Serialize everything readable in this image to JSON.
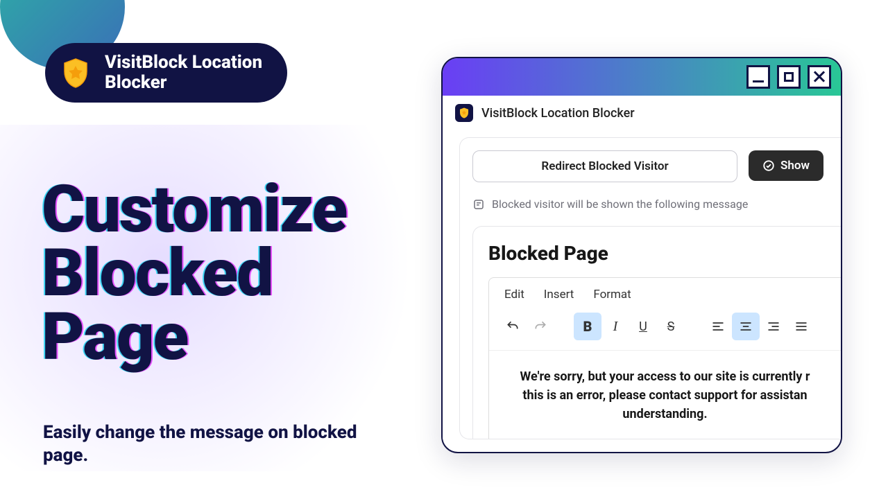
{
  "badge": {
    "label": "VisitBlock Location\nBlocker"
  },
  "headline": "Customize\nBlocked\nPage",
  "subtitle": "Easily change the message on blocked page.",
  "window": {
    "app_title": "VisitBlock Location Blocker",
    "tabs": {
      "redirect_label": "Redirect Blocked Visitor",
      "show_label": "Show"
    },
    "hint": "Blocked visitor will be shown the following message",
    "editor": {
      "title": "Blocked Page",
      "menus": [
        "Edit",
        "Insert",
        "Format"
      ],
      "content": "We're sorry, but your access to our site is currently r\nthis is an error, please contact support for assistan\nunderstanding."
    }
  }
}
